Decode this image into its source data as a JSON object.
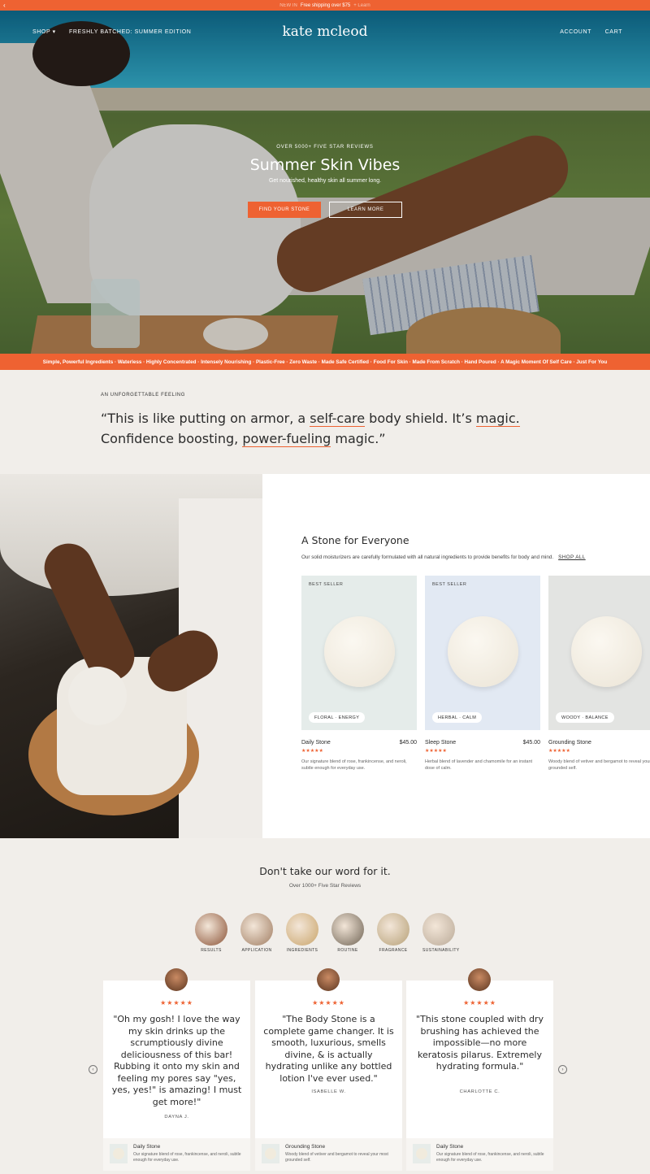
{
  "announcement": {
    "prefix": "NEW IN",
    "text": "Free shipping over $75",
    "suffix": "+ Learn"
  },
  "nav": {
    "shop": "SHOP ▾",
    "featured": "FRESHLY BATCHED: SUMMER EDITION",
    "logo": "kate mcleod",
    "account": "ACCOUNT",
    "cart": "CART"
  },
  "hero": {
    "eyebrow": "OVER 5000+ FIVE STAR REVIEWS",
    "title": "Summer Skin Vibes",
    "subtitle": "Get nourished, healthy skin all summer long.",
    "primary_cta": "FIND YOUR STONE",
    "secondary_cta": "LEARN MORE"
  },
  "ticker": "Simple, Powerful Ingredients · Waterless · Highly Concentrated · Intensely Nourishing · Plastic-Free · Zero Waste · Made Safe Certified · Food For Skin · Made From Scratch · Hand Poured · A Magic Moment Of Self Care · Just For You",
  "quote": {
    "eyebrow": "AN UNFORGETTABLE FEELING",
    "p1": "“This is like putting on armor, a ",
    "u1": "self-care",
    "p2": " body shield. It’s ",
    "u2": "magic.",
    "p3": "Confidence boosting, ",
    "u3": "power-fueling",
    "p4": " magic.”"
  },
  "stones": {
    "title": "A Stone for Everyone",
    "description": "Our solid moisturizers are carefully formulated with all natural ingredients to provide benefits for body and mind.",
    "shop_all": "SHOP ALL",
    "items": [
      {
        "badge": "BEST SELLER",
        "tag": "FLORAL · ENERGY",
        "name": "Daily Stone",
        "price": "$45.00",
        "stars": "★★★★★",
        "desc": "Our signature blend of rose, frankincense, and neroli, subtle enough for everyday use.",
        "bg": "#e5ecea"
      },
      {
        "badge": "BEST SELLER",
        "tag": "HERBAL · CALM",
        "name": "Sleep Stone",
        "price": "$45.00",
        "stars": "★★★★★",
        "desc": "Herbal blend of lavender and chamomile for an instant dose of calm.",
        "bg": "#e2e9f3"
      },
      {
        "badge": "",
        "tag": "WOODY · BALANCE",
        "name": "Grounding Stone",
        "price": "$",
        "stars": "★★★★★",
        "desc": "Woody blend of vetiver and bergamot to reveal your most grounded self.",
        "bg": "#e3e4e2"
      }
    ]
  },
  "reviews": {
    "title": "Don't take our word for it.",
    "subtitle": "Over 1000+ Five Star Reviews",
    "categories": [
      {
        "label": "RESULTS",
        "color": "#8a5236"
      },
      {
        "label": "APPLICATION",
        "color": "#a07d62"
      },
      {
        "label": "INGREDIENTS",
        "color": "#c9a46a"
      },
      {
        "label": "ROUTINE",
        "color": "#6e6253"
      },
      {
        "label": "FRAGRANCE",
        "color": "#b6a077"
      },
      {
        "label": "SUSTAINABILITY",
        "color": "#b9a997"
      }
    ],
    "cards": [
      {
        "stars": "★★★★★",
        "body": "\"Oh my gosh! I love the way my skin drinks up the scrumptiously divine deliciousness of this bar! Rubbing it onto my skin and feeling my pores say \"yes, yes, yes!\" is amazing! I must get more!\"",
        "name": "DAYNA J.",
        "product": "Daily Stone",
        "product_desc": "Our signature blend of rose, frankincense, and neroli, subtle enough for everyday use."
      },
      {
        "stars": "★★★★★",
        "body": "\"The Body Stone is a complete game changer. It is smooth, luxurious, smells divine, & is actually hydrating unlike any bottled lotion I've ever used.\"",
        "name": "ISABELLE W.",
        "product": "Grounding Stone",
        "product_desc": "Woody blend of vetiver and bergamot to reveal your most grounded self."
      },
      {
        "stars": "★★★★★",
        "body": "\"This stone coupled with dry brushing has achieved the impossible—no more keratosis pilarus. Extremely hydrating formula.\"",
        "name": "CHARLOTTE C.",
        "product": "Daily Stone",
        "product_desc": "Our signature blend of rose, frankincense, and neroli, subtle enough for everyday use."
      }
    ]
  },
  "colors": {
    "accent": "#ee6232",
    "background": "#f1eeea"
  }
}
